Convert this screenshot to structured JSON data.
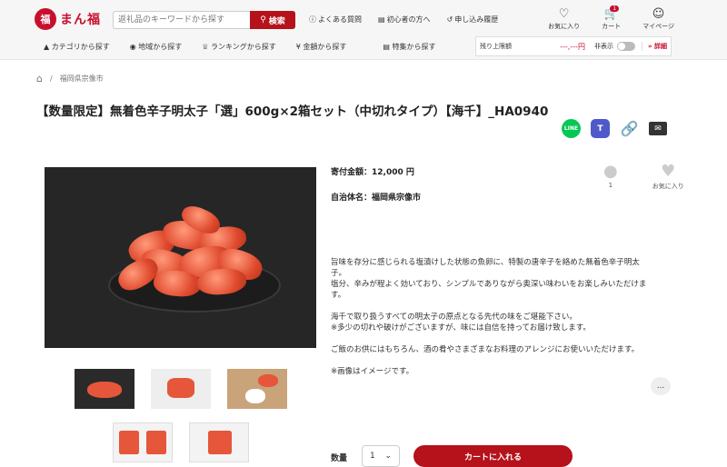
{
  "header": {
    "logo": {
      "mark": "福",
      "text": "まん福"
    },
    "search": {
      "placeholder": "返礼品のキーワードから探す",
      "button_label": "検索"
    },
    "toplinks": [
      {
        "label": "よくある質問"
      },
      {
        "label": "初心者の方へ"
      },
      {
        "label": "申し込み履歴"
      }
    ],
    "icons": [
      {
        "label": "お気に入り",
        "icon": "heart-icon"
      },
      {
        "label": "カート",
        "icon": "cart-icon",
        "badge": "1"
      },
      {
        "label": "マイページ",
        "icon": "user-icon"
      }
    ],
    "nav": [
      {
        "label": "カテゴリから探す"
      },
      {
        "label": "地域から探す"
      },
      {
        "label": "ランキングから探す"
      },
      {
        "label": "金額から探す"
      },
      {
        "label": "特集から探す"
      }
    ],
    "limit": {
      "label": "残り上限額",
      "amount": "---,---円",
      "hide_label": "非表示",
      "detail_label": "詳細"
    }
  },
  "breadcrumb": {
    "item": "福岡県宗像市"
  },
  "product": {
    "title": "【数量限定】無着色辛子明太子「選」600g×2箱セット（中切れタイプ）【海千】_HA0940",
    "price": "寄付金額：12,000 円",
    "municipality": "自治体名：福岡県宗像市",
    "counter_value": "1",
    "favorite_label": "お気に入り",
    "description": [
      "旨味を存分に感じられる塩漬けした状態の魚卵に、特製の唐辛子を絡めた無着色辛子明太子。\n塩分、辛みが程よく効いており、シンプルでありながら奥深い味わいをお楽しみいただけます。",
      "海千で取り扱うすべての明太子の原点となる先代の味をご堪能下さい。\n※多少の切れや破けがございますが、味には自信を持ってお届け致します。",
      "ご飯のお供にはもちろん、酒の肴やさまざまなお料理のアレンジにお使いいただけます。",
      "※画像はイメージです。"
    ],
    "more_label": "...",
    "qty_label": "数量",
    "qty_value": "1",
    "cart_label": "カートに入れる"
  },
  "share": {
    "line": "LINE"
  },
  "colors": {
    "brand": "#c8102e",
    "button": "#b5121b"
  }
}
